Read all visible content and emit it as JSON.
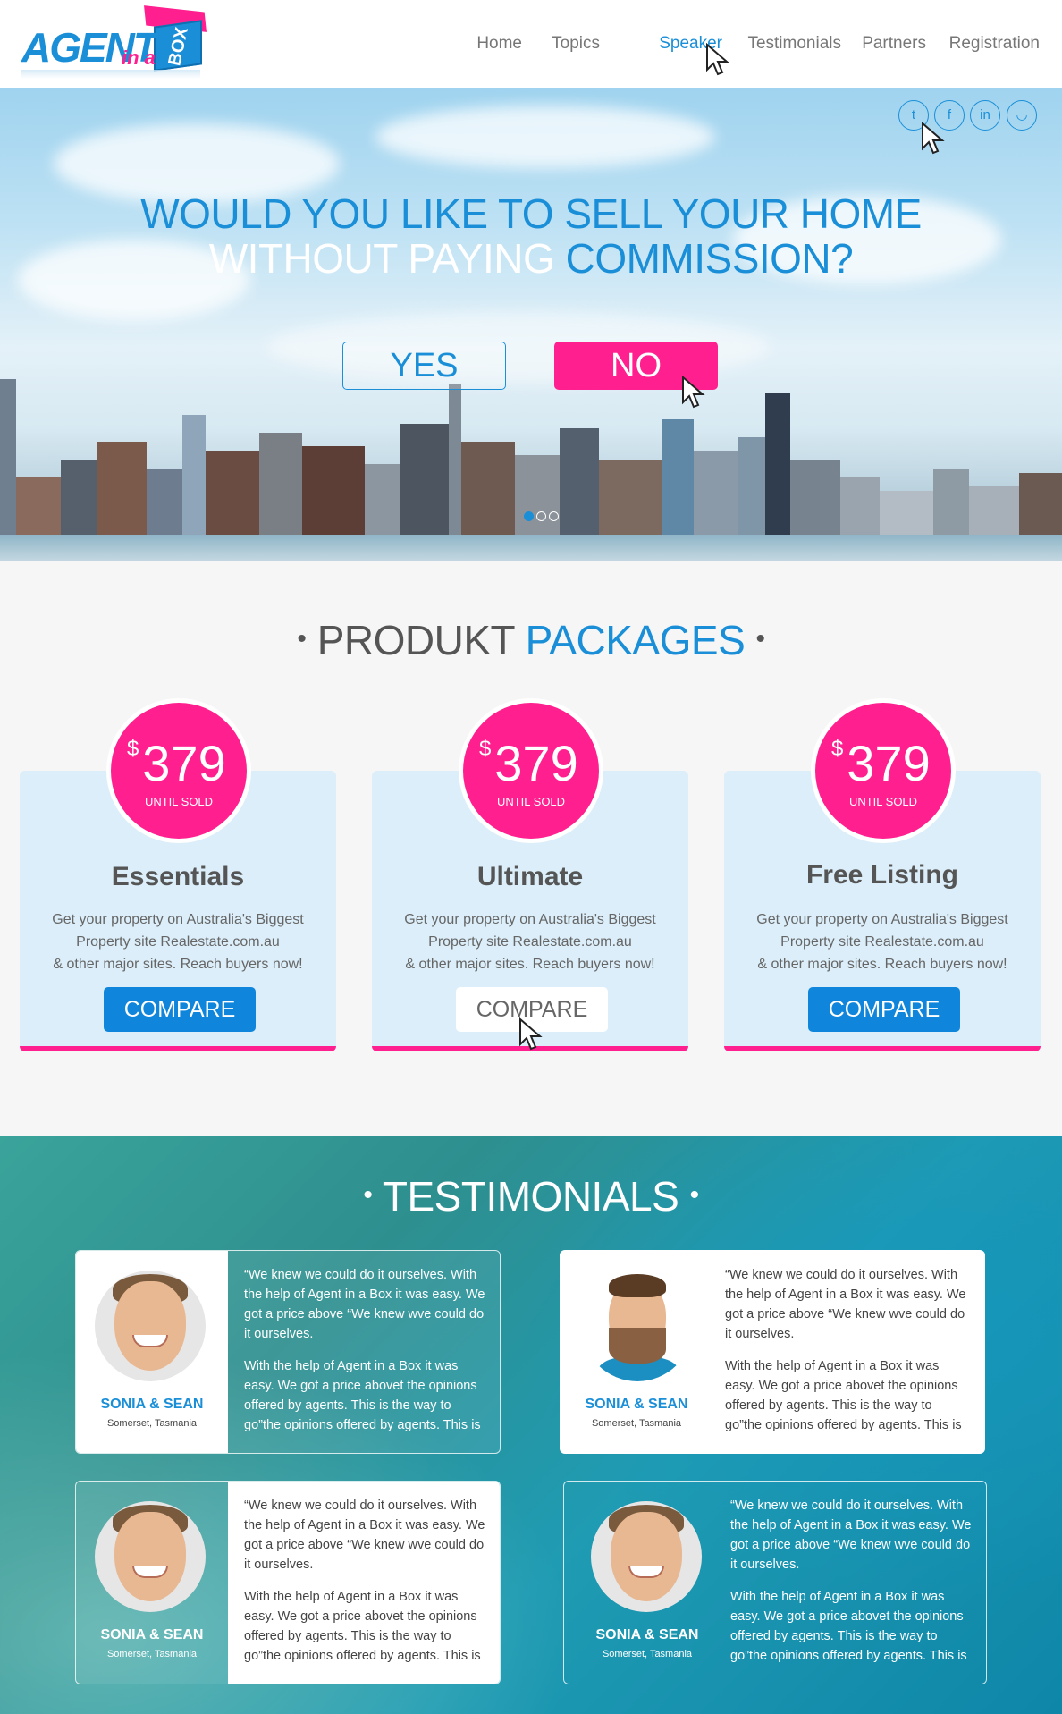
{
  "brand": {
    "logo_word1": "AGENT",
    "logo_word2": "in a",
    "logo_word3": "BOX"
  },
  "nav": {
    "items": [
      {
        "label": "Home"
      },
      {
        "label": "Topics"
      },
      {
        "label": "Speaker",
        "active": true
      },
      {
        "label": "Testimonials"
      },
      {
        "label": "Partners"
      },
      {
        "label": "Registration"
      }
    ]
  },
  "social": {
    "icons": [
      {
        "name": "twitter-icon",
        "glyph": "t"
      },
      {
        "name": "facebook-icon",
        "glyph": "f"
      },
      {
        "name": "linkedin-icon",
        "glyph": "in"
      },
      {
        "name": "rss-icon",
        "glyph": "◡"
      }
    ]
  },
  "hero": {
    "line1": "WOULD YOU LIKE TO SELL YOUR HOME",
    "line2a": "WITHOUT PAYING ",
    "line2b": "COMMISSION?",
    "yes_label": "YES",
    "no_label": "NO",
    "slide_count": 3,
    "active_slide": 1
  },
  "packages": {
    "title_a": "PRODUKT ",
    "title_b": "PACKAGES",
    "bullet": "•",
    "cards": [
      {
        "currency": "$",
        "price": "379",
        "price_note": "UNTIL SOLD",
        "title": "Essentials",
        "desc_line1": "Get your property on Australia's Biggest",
        "desc_line2": "Property site  Realestate.com.au",
        "desc_line3": "& other major sites. Reach buyers now!",
        "button": "COMPARE"
      },
      {
        "currency": "$",
        "price": "379",
        "price_note": "UNTIL SOLD",
        "title": "Ultimate",
        "desc_line1": "Get your property on Australia's Biggest",
        "desc_line2": "Property site  Realestate.com.au",
        "desc_line3": "& other major sites. Reach buyers now!",
        "button": "COMPARE"
      },
      {
        "currency": "$",
        "price": "379",
        "price_note": "UNTIL SOLD",
        "title": "Free Listing",
        "desc_line1": "Get your property on Australia's Biggest",
        "desc_line2": "Property site  Realestate.com.au",
        "desc_line3": "& other major sites. Reach buyers now!",
        "button": "COMPARE"
      }
    ]
  },
  "testimonials": {
    "title": "TESTIMONIALS",
    "bullet": "•",
    "items": [
      {
        "name": "SONIA & SEAN",
        "location": "Somerset, Tasmania",
        "quote_p1": "“We knew we could do it ourselves. With the help of Agent in a Box it was easy. We got a price above “We knew wve could do it ourselves.",
        "quote_p2": "With the help of Agent in a Box it was easy. We got a price abovet the opinions offered by agents. This is the way to go”the opinions offered by agents. This is"
      },
      {
        "name": "SONIA & SEAN",
        "location": "Somerset, Tasmania",
        "quote_p1": "“We knew we could do it ourselves. With the help of Agent in a Box it was easy. We got a price above “We knew wve could do it ourselves.",
        "quote_p2": "With the help of Agent in a Box it was easy. We got a price abovet the opinions offered by agents. This is the way to go”the opinions offered by agents. This is"
      },
      {
        "name": "SONIA & SEAN",
        "location": "Somerset, Tasmania",
        "quote_p1": "“We knew we could do it ourselves. With the help of Agent in a Box it was easy. We got a price above “We knew wve could do it ourselves.",
        "quote_p2": "With the help of Agent in a Box it was easy. We got a price abovet the opinions offered by agents. This is the way to go”the opinions offered by agents. This is"
      },
      {
        "name": "SONIA & SEAN",
        "location": "Somerset, Tasmania",
        "quote_p1": "“We knew we could do it ourselves. With the help of Agent in a Box it was easy. We got a price above “We knew wve could do it ourselves.",
        "quote_p2": "With the help of Agent in a Box it was easy. We got a price abovet the opinions offered by agents. This is the way to go”the opinions offered by agents. This is"
      }
    ]
  },
  "colors": {
    "accent_blue": "#1a8fd8",
    "accent_pink": "#ff1f8e",
    "card_bg": "#dbeef9"
  }
}
